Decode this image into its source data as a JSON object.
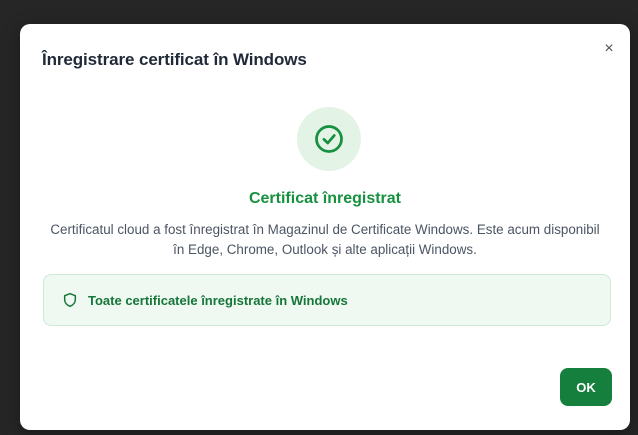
{
  "dialog": {
    "title": "Înregistrare certificat în Windows",
    "close_label": "×",
    "icon": "check-circle-icon",
    "heading": "Certificat înregistrat",
    "description": "Certificatul cloud a fost înregistrat în Magazinul de Certificate Windows. Este acum disponibil în Edge, Chrome, Outlook și alte aplicații Windows.",
    "info": {
      "icon": "shield-icon",
      "text": "Toate certificatele înregistrate în Windows"
    },
    "ok_label": "OK"
  },
  "colors": {
    "accent": "#16913f",
    "button": "#15803d",
    "info_bg": "#eff8f1",
    "success_circle_bg": "#e3f3e6"
  }
}
